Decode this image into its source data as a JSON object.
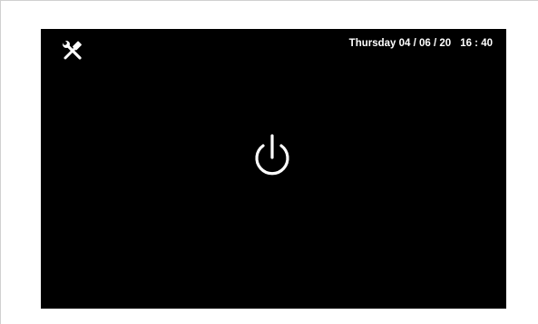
{
  "device": {
    "screen_color": "#000000",
    "foreground_color": "#ffffff"
  },
  "status_bar": {
    "tools_icon": "wrench-screwdriver-icon",
    "date": "Thursday 04 / 06 / 20",
    "time": "16 : 40"
  },
  "main": {
    "power_icon": "power-icon"
  }
}
